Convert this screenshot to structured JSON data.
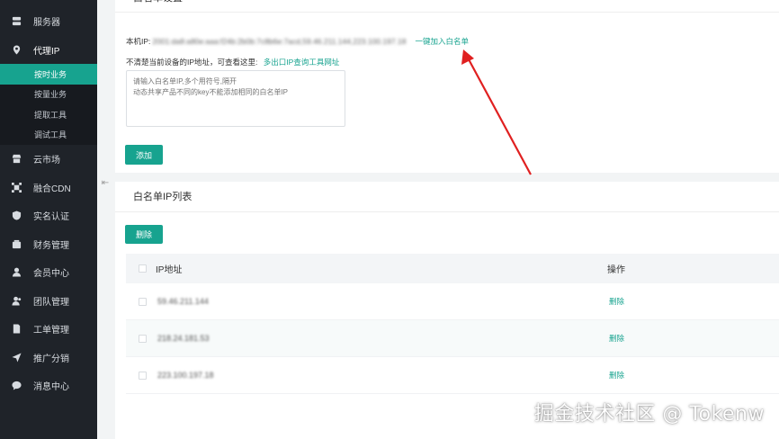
{
  "sidebar": {
    "items": [
      {
        "label": "服务器",
        "icon": "server-icon"
      },
      {
        "label": "代理IP",
        "icon": "location-pin-icon"
      },
      {
        "label": "云市场",
        "icon": "store-icon"
      },
      {
        "label": "融合CDN",
        "icon": "cdn-icon"
      },
      {
        "label": "实名认证",
        "icon": "shield-check-icon"
      },
      {
        "label": "财务管理",
        "icon": "wallet-icon"
      },
      {
        "label": "会员中心",
        "icon": "user-icon"
      },
      {
        "label": "团队管理",
        "icon": "team-icon"
      },
      {
        "label": "工单管理",
        "icon": "ticket-icon"
      },
      {
        "label": "推广分销",
        "icon": "send-icon"
      },
      {
        "label": "消息中心",
        "icon": "message-icon"
      }
    ],
    "sub_items": [
      "按时业务",
      "按量业务",
      "提取工具",
      "调试工具"
    ]
  },
  "whitelist_settings": {
    "title": "白名单设置",
    "local_ip_label": "本机IP:",
    "local_ip_value": "2001:da8:a80e:aaa:f24b:2b0b:7c8b6e:7acd,59.46.211.144,223.100.197.18",
    "one_click_link": "一键加入白名单",
    "hint_text": "不清楚当前设备的IP地址，可查看这里:",
    "tool_link": "多出口IP查询工具网址",
    "textarea_placeholder": "请输入白名单IP,多个用符号,隔开\n动态共享产品不同的key不能添加相同的白名单IP",
    "add_button": "添加"
  },
  "whitelist_list": {
    "title": "白名单IP列表",
    "delete_button": "删除",
    "columns": [
      "IP地址",
      "操作"
    ],
    "rows": [
      {
        "ip": "59.46.211.144",
        "action": "删除"
      },
      {
        "ip": "218.24.181.53",
        "action": "删除"
      },
      {
        "ip": "223.100.197.18",
        "action": "删除"
      }
    ]
  },
  "watermark": "掘金技术社区 @ Tokenw",
  "colors": {
    "accent": "#17a38f",
    "sidebar_bg": "#1f2329",
    "arrow": "#e02020"
  }
}
